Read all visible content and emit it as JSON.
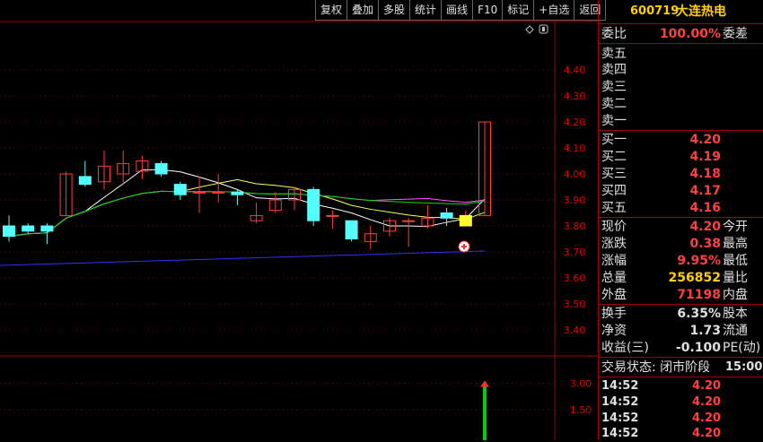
{
  "toolbar": {
    "buttons": [
      "复权",
      "叠加",
      "多股",
      "统计",
      "画线",
      "F10",
      "标记",
      "+自选",
      "返回"
    ]
  },
  "chart": {
    "price_axis": [
      "4.40",
      "4.30",
      "4.20",
      "4.10",
      "4.00",
      "3.90",
      "3.80",
      "3.70",
      "3.60",
      "3.50",
      "3.40"
    ],
    "volume_axis": [
      "3.00",
      "1.50"
    ]
  },
  "chart_data": {
    "type": "candlestick",
    "ylim": [
      3.35,
      4.45
    ],
    "ohlc": [
      {
        "o": 3.8,
        "c": 3.76,
        "h": 3.84,
        "l": 3.74
      },
      {
        "o": 3.8,
        "c": 3.78,
        "h": 3.81,
        "l": 3.77
      },
      {
        "o": 3.8,
        "c": 3.78,
        "h": 3.81,
        "l": 3.73
      },
      {
        "o": 3.84,
        "c": 4.0,
        "h": 4.01,
        "l": 3.84
      },
      {
        "o": 3.99,
        "c": 3.96,
        "h": 4.05,
        "l": 3.95
      },
      {
        "o": 3.97,
        "c": 4.03,
        "h": 4.09,
        "l": 3.94
      },
      {
        "o": 4.0,
        "c": 4.04,
        "h": 4.09,
        "l": 3.96
      },
      {
        "o": 4.01,
        "c": 4.05,
        "h": 4.07,
        "l": 3.98
      },
      {
        "o": 4.04,
        "c": 4.0,
        "h": 4.05,
        "l": 3.99
      },
      {
        "o": 3.96,
        "c": 3.92,
        "h": 3.97,
        "l": 3.9
      },
      {
        "o": 3.93,
        "c": 3.93,
        "h": 3.99,
        "l": 3.85
      },
      {
        "o": 3.93,
        "c": 3.93,
        "h": 4.0,
        "l": 3.89
      },
      {
        "o": 3.93,
        "c": 3.92,
        "h": 3.94,
        "l": 3.88
      },
      {
        "o": 3.82,
        "c": 3.84,
        "h": 3.89,
        "l": 3.81
      },
      {
        "o": 3.86,
        "c": 3.9,
        "h": 3.93,
        "l": 3.85
      },
      {
        "o": 3.9,
        "c": 3.94,
        "h": 3.95,
        "l": 3.86
      },
      {
        "o": 3.94,
        "c": 3.82,
        "h": 3.95,
        "l": 3.8
      },
      {
        "o": 3.84,
        "c": 3.84,
        "h": 3.86,
        "l": 3.79
      },
      {
        "o": 3.82,
        "c": 3.75,
        "h": 3.82,
        "l": 3.74
      },
      {
        "o": 3.74,
        "c": 3.77,
        "h": 3.8,
        "l": 3.71
      },
      {
        "o": 3.78,
        "c": 3.82,
        "h": 3.83,
        "l": 3.76
      },
      {
        "o": 3.82,
        "c": 3.82,
        "h": 3.83,
        "l": 3.72
      },
      {
        "o": 3.8,
        "c": 3.83,
        "h": 3.88,
        "l": 3.79
      },
      {
        "o": 3.85,
        "c": 3.83,
        "h": 3.87,
        "l": 3.8
      },
      {
        "o": 3.82,
        "c": 3.84,
        "h": 3.86,
        "l": 3.81
      },
      {
        "o": 3.84,
        "c": 4.2,
        "h": 4.2,
        "l": 3.84
      }
    ],
    "last_volume": 3.0
  },
  "panel": {
    "code": "600719",
    "name": "大连热电",
    "weibi": {
      "label": "委比",
      "value": "100.00%",
      "label2": "委差"
    },
    "sells": [
      "卖五",
      "卖四",
      "卖三",
      "卖二",
      "卖一"
    ],
    "buys": [
      {
        "label": "买一",
        "price": "4.20"
      },
      {
        "label": "买二",
        "price": "4.19"
      },
      {
        "label": "买三",
        "price": "4.18"
      },
      {
        "label": "买四",
        "price": "4.17"
      },
      {
        "label": "买五",
        "price": "4.16"
      }
    ],
    "quote": [
      {
        "label": "现价",
        "value": "4.20",
        "label2": "今开",
        "cls": "red"
      },
      {
        "label": "涨跌",
        "value": "0.38",
        "label2": "最高",
        "cls": "red"
      },
      {
        "label": "涨幅",
        "value": "9.95%",
        "label2": "最低",
        "cls": "red"
      },
      {
        "label": "总量",
        "value": "256852",
        "label2": "量比",
        "cls": "yel"
      },
      {
        "label": "外盘",
        "value": "71198",
        "label2": "内盘",
        "cls": "red"
      }
    ],
    "stats": [
      {
        "label": "换手",
        "value": "6.35%",
        "label2": "股本"
      },
      {
        "label": "净资",
        "value": "1.73",
        "label2": "流通"
      },
      {
        "label": "收益(三)",
        "value": "-0.100",
        "label2": "PE(动)"
      }
    ],
    "status_label": "交易状态: 闭市阶段",
    "status_time": "15:00:",
    "ticks": [
      {
        "time": "14:52",
        "price": "4.20"
      },
      {
        "time": "14:52",
        "price": "4.20"
      },
      {
        "time": "14:52",
        "price": "4.20"
      },
      {
        "time": "14:52",
        "price": "4.20"
      }
    ]
  },
  "colors": {
    "up": "#ff3c3c",
    "down": "#54ffff",
    "ma5": "#ffffff",
    "ma10": "#ffff54",
    "ma20": "#ff54ff",
    "ma30": "#00e000",
    "ma60": "#3030ff"
  }
}
